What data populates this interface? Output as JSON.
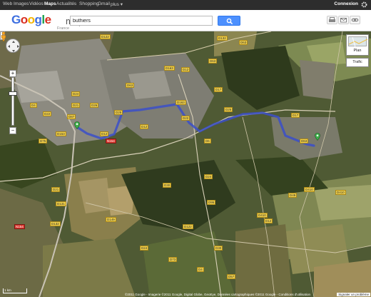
{
  "topnav": {
    "items": [
      "Web",
      "Images",
      "Vidéos",
      "Maps",
      "Actualités",
      "Shopping",
      "Gmail",
      "plus ▾"
    ],
    "active": "Maps",
    "connexion_label": "Connexion"
  },
  "header": {
    "logo_letters": [
      "G",
      "o",
      "o",
      "g",
      "l",
      "e"
    ],
    "logo_colors": [
      "#3c6ee0",
      "#d92e20",
      "#f4b400",
      "#3c6ee0",
      "#1aa14c",
      "#d92e20"
    ],
    "logo_maps": "maps",
    "logo_country": "France",
    "search_value": "buthiers"
  },
  "map": {
    "road_labels": [
      "D122",
      "D132",
      "D63",
      "D63",
      "D87",
      "D22",
      "D25",
      "D153",
      "N154",
      "D163",
      "D6",
      "D24",
      "D21",
      "D24",
      "D12",
      "D63",
      "D149",
      "D95",
      "D30",
      "D21",
      "D122",
      "D12",
      "D24",
      "D73",
      "D4",
      "D57",
      "D63",
      "D75",
      "D12",
      "D4",
      "D132",
      "N154",
      "D131",
      "D410",
      "D163",
      "D22",
      "D17",
      "D25",
      "D49",
      "D26",
      "D12",
      "D410",
      "D410",
      "D17",
      "D30"
    ],
    "layer_plan_label": "Plan",
    "layer_traffic_label": "Trafic",
    "scale_label": "1 km",
    "copyright": "©2011 Google - Imagerie ©2011 Google, Digital Globe, GeoEye, Données cartographiques ©2011 Google - Conditions d'utilisation",
    "report_label": "Signaler un problème"
  },
  "colors": {
    "route": "#3b4fc9",
    "topbar": "#2d2d2d",
    "search_button": "#4d90fe",
    "road_label": "#f3d34d"
  }
}
